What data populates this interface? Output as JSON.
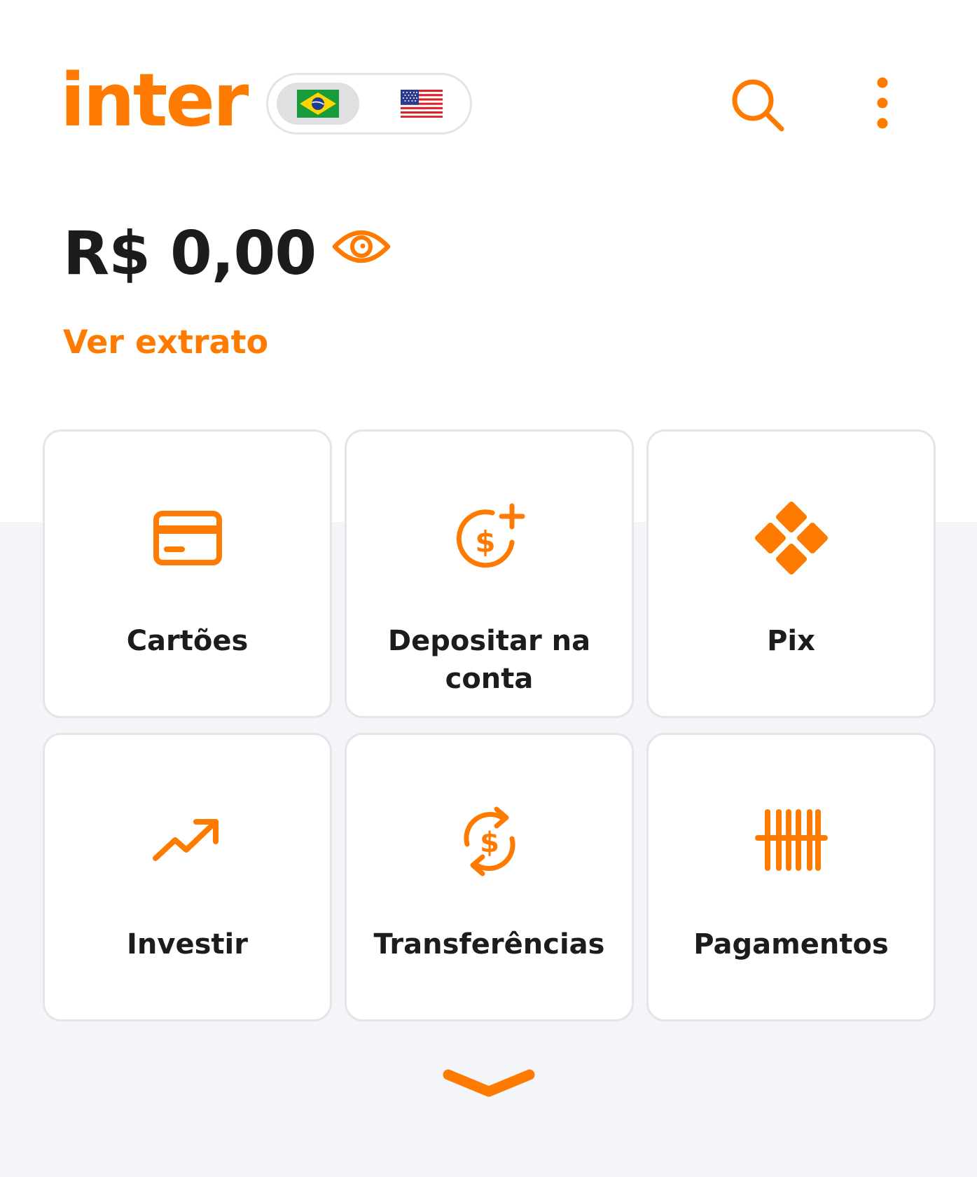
{
  "brand": {
    "logo_text": "inter",
    "accent_color": "#ff7a00"
  },
  "header": {
    "currency_toggle": {
      "options": [
        "brazil-flag-icon",
        "usa-flag-icon"
      ],
      "selected": "brazil-flag-icon"
    },
    "actions": [
      "search-icon",
      "more-vertical-icon"
    ]
  },
  "balance": {
    "amount": "R$ 0,00",
    "visibility_icon": "eye-icon",
    "statement_link": "Ver extrato"
  },
  "shortcuts": [
    {
      "label": "Cartões",
      "icon": "credit-card-icon"
    },
    {
      "label": "Depositar na conta",
      "icon": "deposit-icon"
    },
    {
      "label": "Pix",
      "icon": "pix-icon"
    },
    {
      "label": "Investir",
      "icon": "trending-up-icon"
    },
    {
      "label": "Transferências",
      "icon": "transfer-icon"
    },
    {
      "label": "Pagamentos",
      "icon": "barcode-icon"
    }
  ],
  "footer": {
    "expand_icon": "chevron-down-icon"
  }
}
